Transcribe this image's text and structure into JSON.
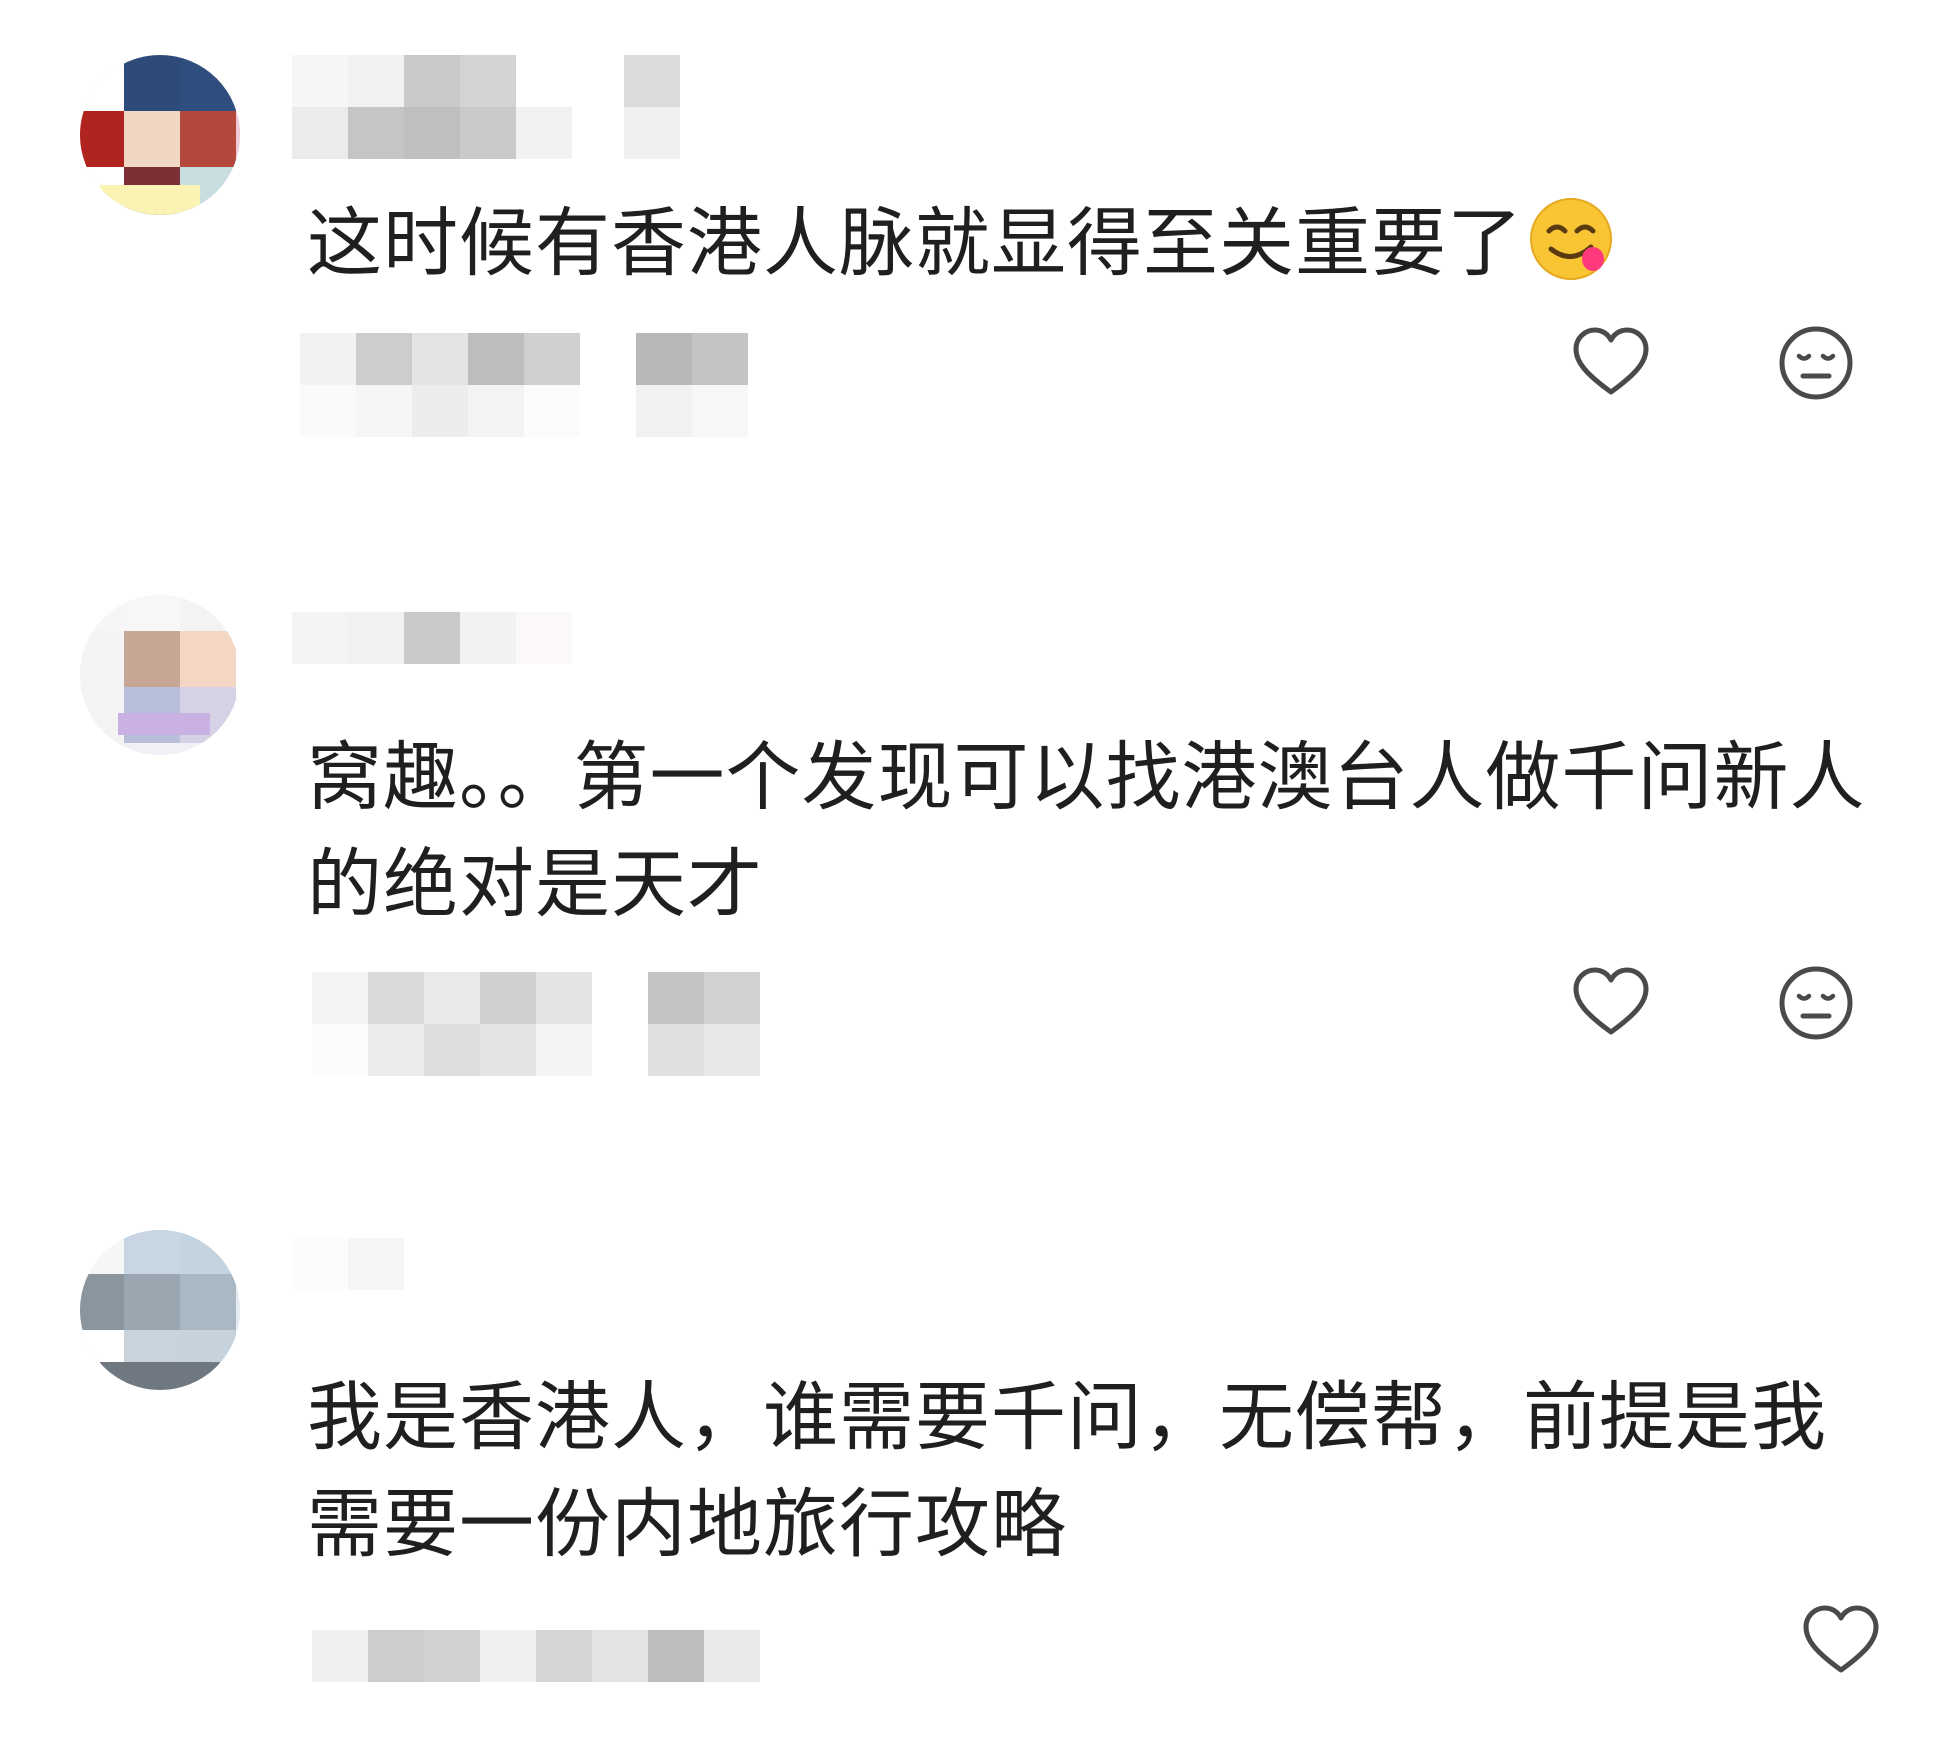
{
  "comments": [
    {
      "text": "这时候有香港人脉就显得至关重要了",
      "emoji": "yum-face-emoji",
      "actions": [
        "heart-icon",
        "neutral-face-icon"
      ]
    },
    {
      "text": "窝趣。。第一个发现可以找港澳台人做千问新人的绝对是天才",
      "actions": [
        "heart-icon",
        "neutral-face-icon"
      ]
    },
    {
      "text": "我是香港人，谁需要千问，无偿帮，前提是我需要一份内地旅行攻略",
      "actions": [
        "heart-icon"
      ]
    }
  ],
  "colors": {
    "text": "#1f1f1f",
    "icon_stroke": "#4a4a4a",
    "background": "#ffffff"
  }
}
